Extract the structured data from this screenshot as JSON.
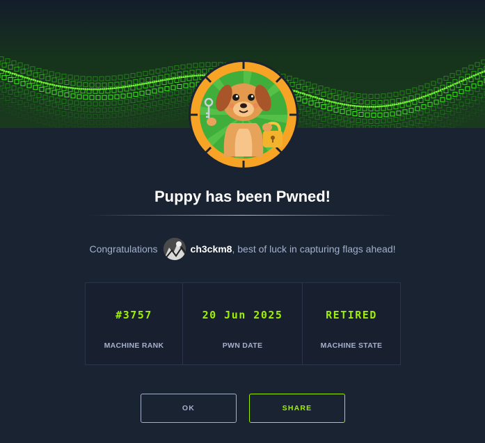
{
  "title": "Puppy has been Pwned!",
  "congrats": {
    "prefix": "Congratulations",
    "username": "ch3ckm8",
    "suffix": ", best of luck in capturing flags ahead!"
  },
  "stats": [
    {
      "value": "#3757",
      "label": "MACHINE RANK"
    },
    {
      "value": "20 Jun 2025",
      "label": "PWN DATE"
    },
    {
      "value": "RETIRED",
      "label": "MACHINE STATE"
    }
  ],
  "buttons": {
    "ok_label": "OK",
    "share_label": "SHARE"
  },
  "colors": {
    "background": "#1a2332",
    "accent": "#9fef00",
    "muted_text": "#a4b1cd",
    "badge_ring": "#f7a325"
  },
  "icons": {
    "badge": "puppy-machine-badge",
    "avatar": "user-avatar"
  }
}
